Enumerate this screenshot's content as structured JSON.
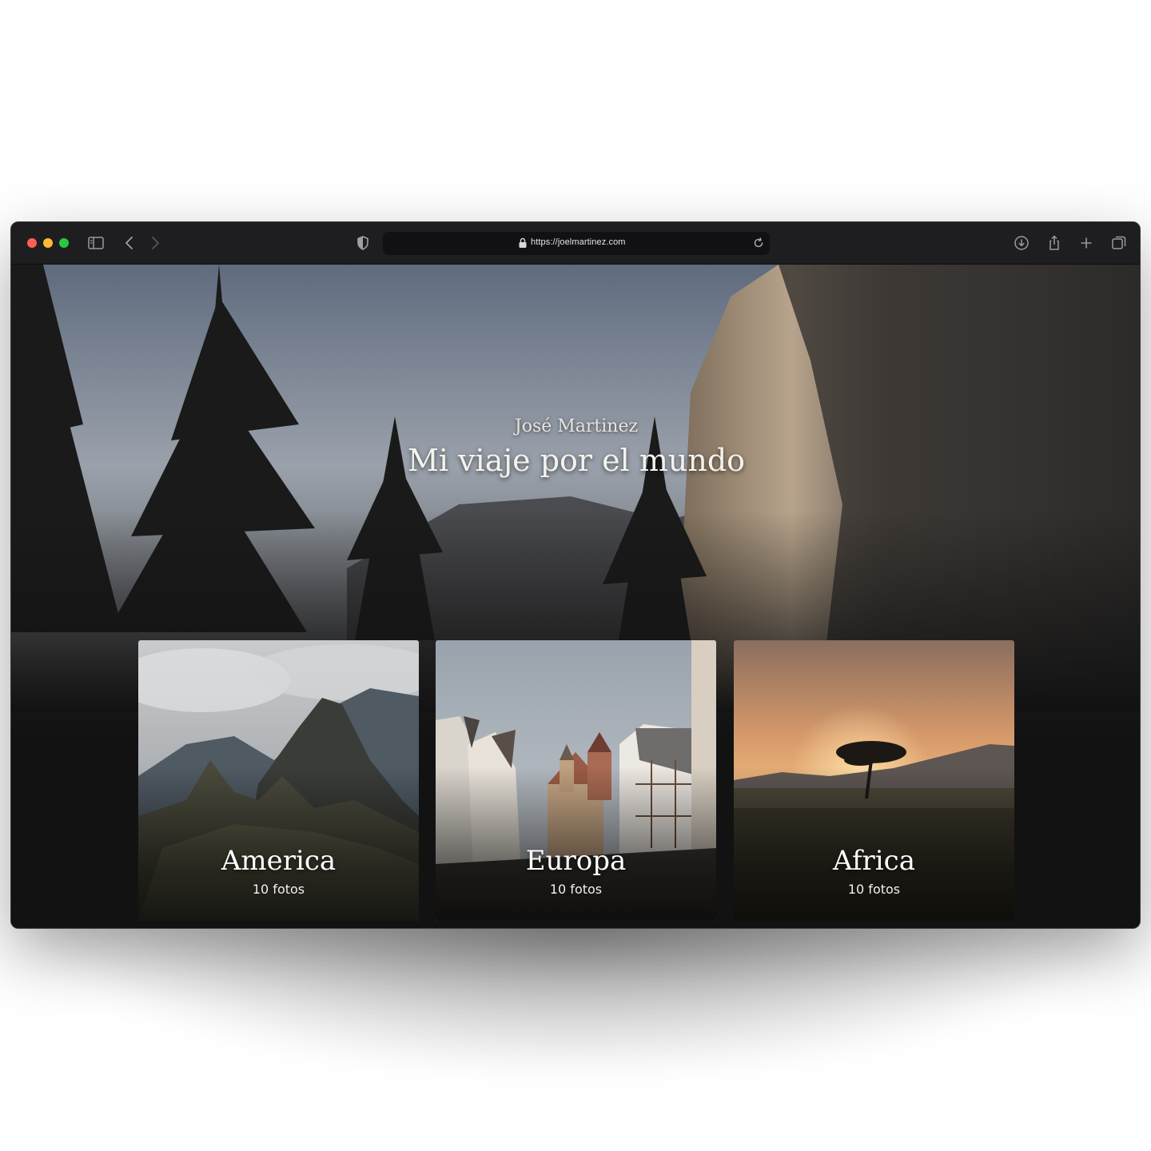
{
  "browser": {
    "url": "https://joelmartinez.com",
    "icons": [
      "sidebar-icon",
      "back-icon",
      "forward-icon",
      "shield-icon",
      "lock-icon",
      "reload-icon",
      "download-icon",
      "share-icon",
      "new-tab-icon",
      "tabs-overview-icon"
    ]
  },
  "hero": {
    "subtitle": "José Martinez",
    "title": "Mi viaje por el mundo"
  },
  "galleries": [
    {
      "name": "America",
      "count": "10 fotos"
    },
    {
      "name": "Europa",
      "count": "10 fotos"
    },
    {
      "name": "Africa",
      "count": "10 fotos"
    }
  ],
  "colors": {
    "traffic_red": "#ff5f57",
    "traffic_yellow": "#febc2e",
    "traffic_green": "#28c840",
    "toolbar": "#1e1e20",
    "page_background": "#121212"
  }
}
